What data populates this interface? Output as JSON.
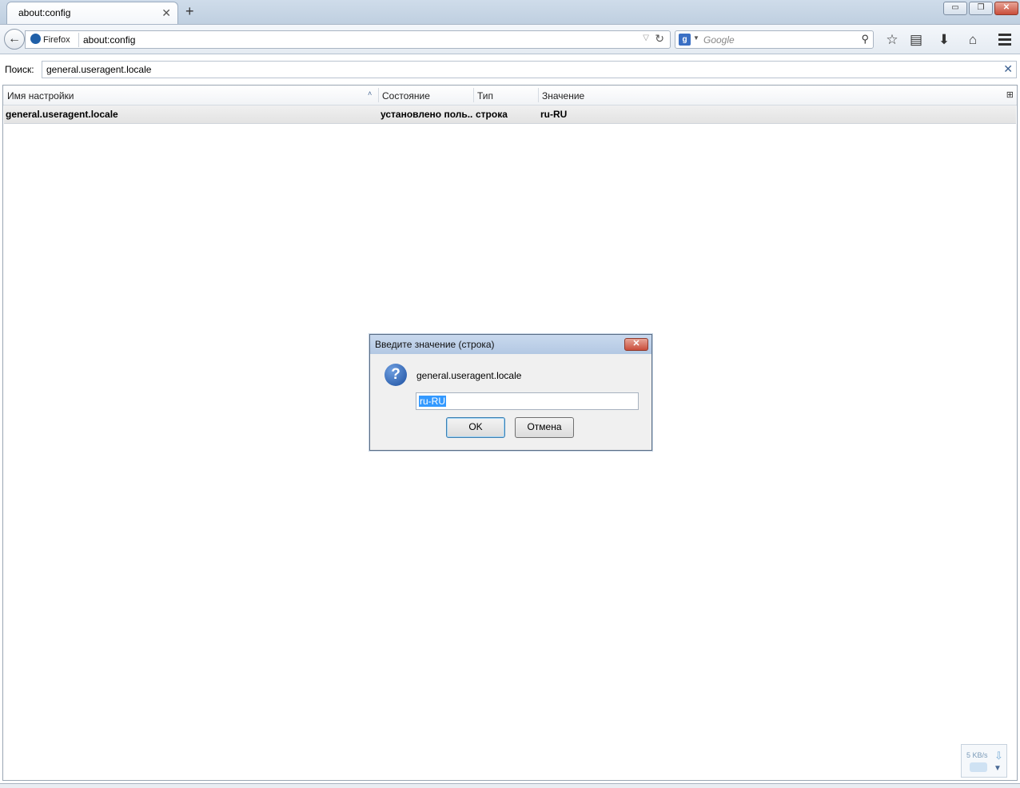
{
  "tab": {
    "title": "about:config",
    "close": "✕"
  },
  "newtab": "+",
  "window_controls": {
    "minimize": "▭",
    "maximize": "❐",
    "close": "✕"
  },
  "navbar": {
    "back": "←",
    "identity": "Firefox",
    "url": "about:config",
    "url_dropdown": "▽",
    "reload": "↻",
    "search_engine": "g",
    "search_placeholder": "Google",
    "search_go": "⚲",
    "icons": {
      "bookmark": "☆",
      "bookmarks_menu": "▤",
      "downloads": "⬇",
      "home": "⌂"
    }
  },
  "search": {
    "label": "Поиск:",
    "value": "general.useragent.locale",
    "clear": "✕"
  },
  "tree": {
    "columns": [
      "Имя настройки",
      "Состояние",
      "Тип",
      "Значение"
    ],
    "sort_indicator": "˄",
    "column_picker": "⊞",
    "rows": [
      {
        "name": "general.useragent.locale",
        "status": "установлено поль...",
        "type": "строка",
        "value": "ru-RU"
      }
    ]
  },
  "dialog": {
    "title": "Введите значение (строка)",
    "close": "✕",
    "icon": "?",
    "message": "general.useragent.locale",
    "input_value": "ru-RU",
    "ok": "OK",
    "cancel": "Отмена"
  },
  "download_widget": {
    "speed": "5 KB/s",
    "arrow": "⇩",
    "dropdown": "▼"
  }
}
